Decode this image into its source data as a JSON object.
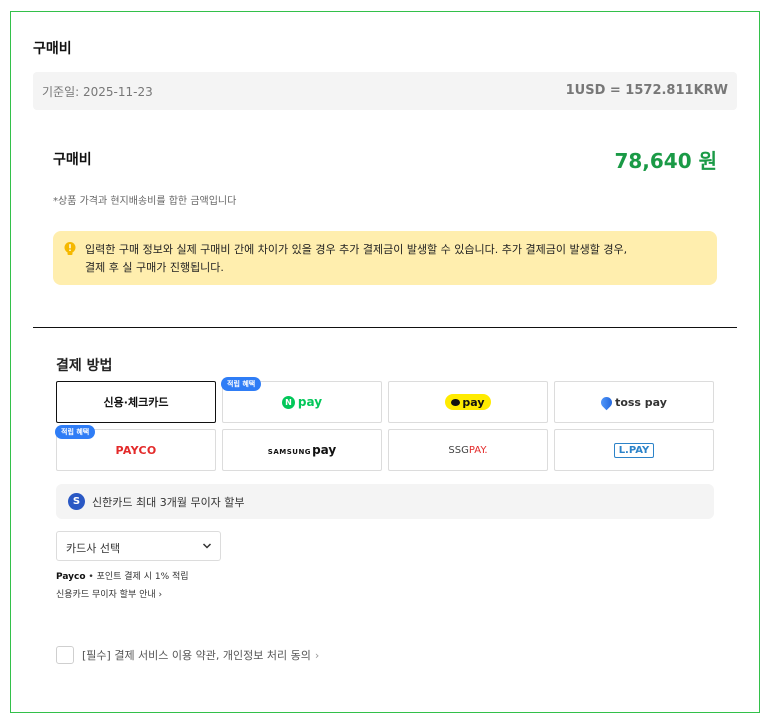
{
  "purchase": {
    "section_title": "구매비",
    "rate": {
      "date": "기준일: 2025-11-23",
      "value": "1USD = 1572.811KRW"
    },
    "price_label": "구매비",
    "price_value": "78,640 원",
    "price_note": "*상품 가격과 현지배송비를 합한 금액입니다",
    "notice_line1": "입력한 구매 정보와 실제 구매비 간에 차이가 있을 경우 추가 결제금이 발생할 수 있습니다. 추가 결제금이 발생할 경우,",
    "notice_line2": "결제 후 실 구매가 진행됩니다."
  },
  "payment": {
    "title": "결제 방법",
    "badge_label": "적립 혜택",
    "methods": {
      "card": "신용·체크카드",
      "npay_n": "N",
      "npay": "pay",
      "kakaopay": "pay",
      "tosspay": "toss pay",
      "payco": "PAYCO",
      "samsung_a": "SAMSUNG",
      "samsung_b": "pay",
      "ssg_a": "SSG",
      "ssg_b": "PAY.",
      "lpay": "L.PAY"
    },
    "shinhan_icon_letter": "S",
    "shinhan_text": "신한카드 최대 3개월 무이자 할부",
    "card_select_value": "카드사 선택",
    "payco_brand": "Payco",
    "payco_note": " • 포인트 결제 시 1% 적립",
    "installment_guide": "신용카드 무이자 할부 안내",
    "guide_chevron": "›",
    "agreement": "[필수] 결제 서비스 이용 약관, 개인정보 처리 동의",
    "agreement_chevron": "›"
  },
  "colors": {
    "frame_border": "#33c04a",
    "price_green": "#1a9a46",
    "notice_bg": "#ffeeae",
    "badge_blue": "#2f7df6",
    "npay_green": "#03c75a",
    "kakao_yellow": "#ffeb00",
    "payco_red": "#e32a2a"
  }
}
